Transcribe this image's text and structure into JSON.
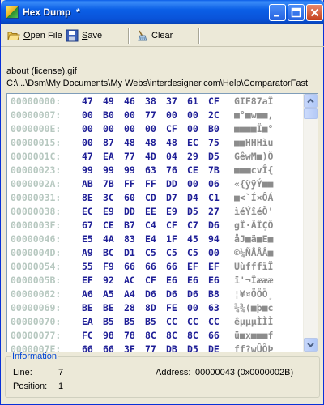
{
  "window": {
    "title": "Hex Dump  *"
  },
  "toolbar": {
    "open_label": "Open File",
    "save_label": "Save",
    "clear_label": "Clear"
  },
  "file": {
    "name": "about (license).gif",
    "path": "C:\\...\\Dsm\\My Documents\\My Webs\\interdesigner.com\\Help\\ComparatorFast"
  },
  "hex_rows": [
    {
      "offset": "00000000:",
      "bytes": [
        "47",
        "49",
        "46",
        "38",
        "37",
        "61",
        "CF"
      ],
      "ascii": "GIF87aÏ"
    },
    {
      "offset": "00000007:",
      "bytes": [
        "00",
        "B0",
        "00",
        "77",
        "00",
        "00",
        "2C"
      ],
      "ascii": "■°■w■■,"
    },
    {
      "offset": "0000000E:",
      "bytes": [
        "00",
        "00",
        "00",
        "00",
        "CF",
        "00",
        "B0"
      ],
      "ascii": "■■■■Ï■°"
    },
    {
      "offset": "00000015:",
      "bytes": [
        "00",
        "87",
        "48",
        "48",
        "48",
        "EC",
        "75"
      ],
      "ascii": "■■HHHìu"
    },
    {
      "offset": "0000001C:",
      "bytes": [
        "47",
        "EA",
        "77",
        "4D",
        "04",
        "29",
        "D5"
      ],
      "ascii": "GêwM■)Õ"
    },
    {
      "offset": "00000023:",
      "bytes": [
        "99",
        "99",
        "99",
        "63",
        "76",
        "CE",
        "7B"
      ],
      "ascii": "■■■cvÎ{"
    },
    {
      "offset": "0000002A:",
      "bytes": [
        "AB",
        "7B",
        "FF",
        "FF",
        "DD",
        "00",
        "06"
      ],
      "ascii": "«{ÿÿÝ■■"
    },
    {
      "offset": "00000031:",
      "bytes": [
        "8E",
        "3C",
        "60",
        "CD",
        "D7",
        "D4",
        "C1"
      ],
      "ascii": "■<`Í×ÔÁ"
    },
    {
      "offset": "00000038:",
      "bytes": [
        "EC",
        "E9",
        "DD",
        "EE",
        "E9",
        "D5",
        "27"
      ],
      "ascii": "ìéÝîéÕ'"
    },
    {
      "offset": "0000003F:",
      "bytes": [
        "67",
        "CE",
        "B7",
        "C4",
        "CF",
        "C7",
        "D6"
      ],
      "ascii": "gÎ·ÄÏÇÖ"
    },
    {
      "offset": "00000046:",
      "bytes": [
        "E5",
        "4A",
        "83",
        "E4",
        "1F",
        "45",
        "94"
      ],
      "ascii": "åJ■ä■E■"
    },
    {
      "offset": "0000004D:",
      "bytes": [
        "A9",
        "BC",
        "D1",
        "C5",
        "C5",
        "C5",
        "00"
      ],
      "ascii": "©¼ÑÅÅÅ■"
    },
    {
      "offset": "00000054:",
      "bytes": [
        "55",
        "F9",
        "66",
        "66",
        "66",
        "EF",
        "EF"
      ],
      "ascii": "UùfffïÏ"
    },
    {
      "offset": "0000005B:",
      "bytes": [
        "EF",
        "92",
        "AC",
        "CF",
        "E6",
        "E6",
        "E6"
      ],
      "ascii": "ï'¬Ïæææ"
    },
    {
      "offset": "00000062:",
      "bytes": [
        "A6",
        "A5",
        "A4",
        "D6",
        "D6",
        "D6",
        "B8"
      ],
      "ascii": "¦¥¤ÖÖÖ¸"
    },
    {
      "offset": "00000069:",
      "bytes": [
        "BE",
        "BE",
        "28",
        "8D",
        "FE",
        "00",
        "63"
      ],
      "ascii": "¾¾(■þ■c"
    },
    {
      "offset": "00000070:",
      "bytes": [
        "EA",
        "B5",
        "B5",
        "B5",
        "CC",
        "CC",
        "CC"
      ],
      "ascii": "êµµµÌÌÌ"
    },
    {
      "offset": "00000077:",
      "bytes": [
        "FC",
        "98",
        "78",
        "8C",
        "8C",
        "8C",
        "66"
      ],
      "ascii": "ü■x■■■f"
    },
    {
      "offset": "0000007E:",
      "bytes": [
        "66",
        "66",
        "3F",
        "77",
        "DB",
        "D5",
        "DE"
      ],
      "ascii": "ff?wÛÕÞ"
    }
  ],
  "info": {
    "title": "Information",
    "line_label": "Line:",
    "line_value": "7",
    "position_label": "Position:",
    "position_value": "1",
    "address_label": "Address:",
    "address_value": "00000043 (0x0000002B)"
  },
  "colors": {
    "title_bar": "#0B5FE6",
    "offset_text": "#B7C8C0",
    "hex_text": "#1E1E96",
    "ascii_text": "#8C8C8C",
    "info_title": "#0046D5"
  }
}
